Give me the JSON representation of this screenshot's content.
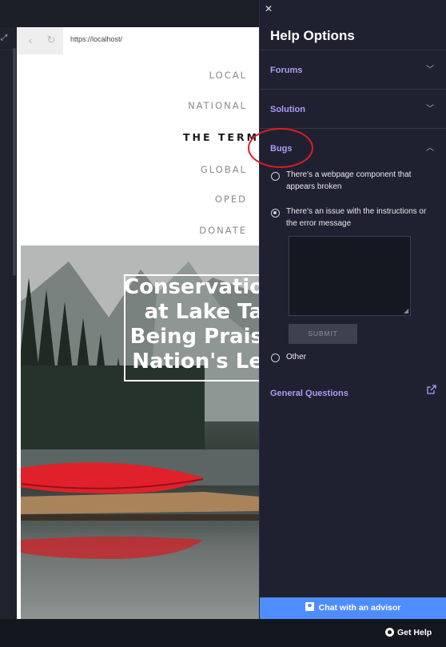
{
  "browser": {
    "url": "https://localhost/",
    "nav": {
      "back_icon": "chevron-left-icon",
      "reload_icon": "reload-icon"
    }
  },
  "site": {
    "nav_items": [
      "LOCAL",
      "NATIONAL",
      "THE TERMIN",
      "GLOBAL",
      "OPED",
      "DONATE"
    ],
    "headline_lines": [
      "Conservatio",
      "at Lake Ta",
      "Being Prais",
      "Nation's Le"
    ]
  },
  "help_panel": {
    "title": "Help Options",
    "sections": {
      "forums": "Forums",
      "solution": "Solution",
      "bugs": "Bugs",
      "general": "General Questions"
    },
    "bug_options": [
      "There's a webpage component that appears broken",
      "There's an issue with the instructions or the error message",
      "Other"
    ],
    "selected_option_index": 1,
    "textarea_value": "",
    "submit_label": "SUBMIT",
    "chat_label": "Chat with an advisor"
  },
  "footer": {
    "get_help_label": "Get Help"
  },
  "colors": {
    "accent": "#a99cf5",
    "chat_button": "#4f8dff",
    "highlight": "#e31b23",
    "panel_bg": "#1f2130"
  }
}
